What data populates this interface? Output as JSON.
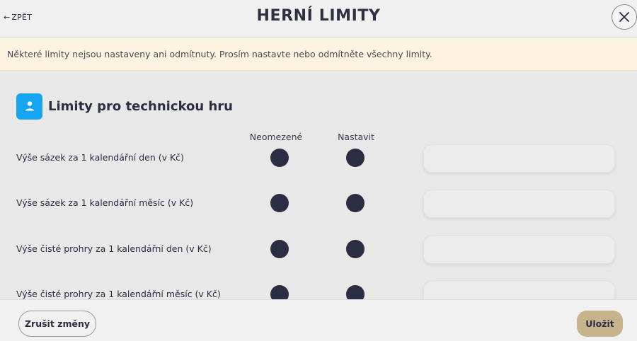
{
  "header": {
    "back_label": "ZPĚT",
    "title": "HERNÍ LIMITY",
    "close_icon": "close-icon"
  },
  "warning": {
    "text": "Některé limity nejsou nastaveny ani odmítnuty. Prosím nastavte nebo odmítněte všechny limity."
  },
  "section": {
    "icon": "user-icon",
    "title": "Limity pro technickou hru",
    "icon_color": "#17a5f2"
  },
  "columns": {
    "unlimited": "Neomezené",
    "set": "Nastavit"
  },
  "rows": [
    {
      "label": "Výše sázek za 1 kalendářní den (v Kč)",
      "value": "",
      "placeholder": ""
    },
    {
      "label": "Výše sázek za 1 kalendářní měsíc (v Kč)",
      "value": "",
      "placeholder": ""
    },
    {
      "label": "Výše čisté prohry za 1 kalendářní den (v Kč)",
      "value": "",
      "placeholder": ""
    },
    {
      "label": "Výše čisté prohry za 1 kalendářní měsíc (v Kč)",
      "value": "",
      "placeholder": ""
    }
  ],
  "footer": {
    "cancel_label": "Zrušit změny",
    "save_label": "Uložit",
    "save_color": "#c8b48c"
  }
}
